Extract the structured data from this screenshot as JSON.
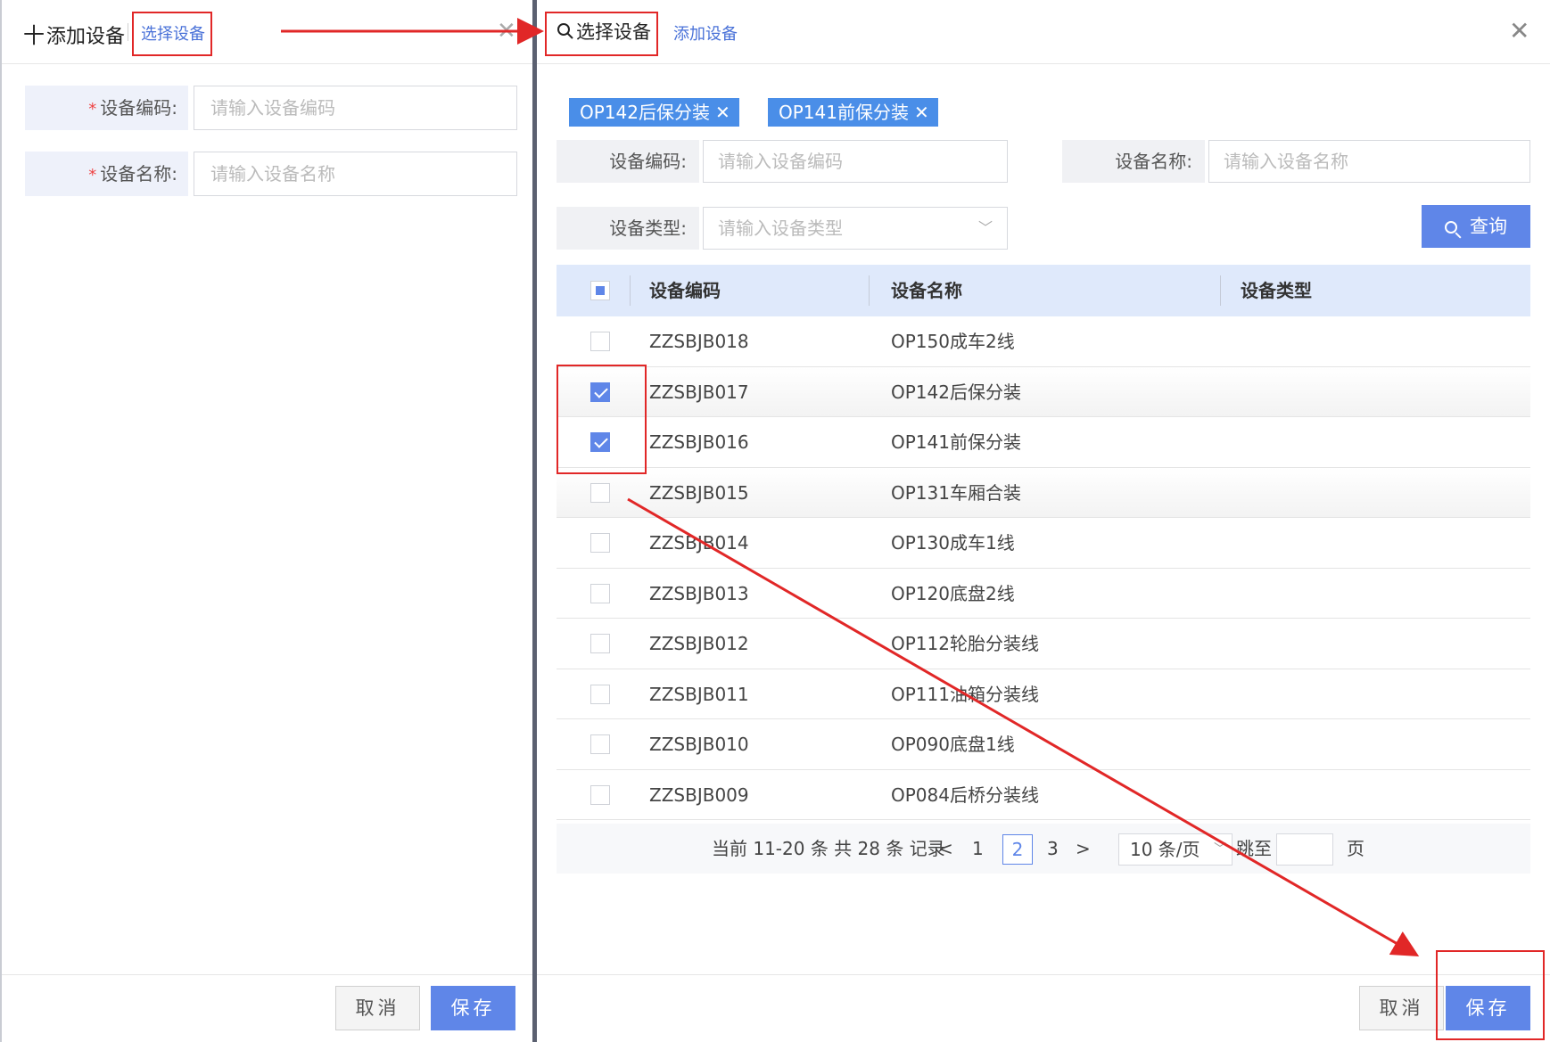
{
  "left_panel": {
    "tab_active": "添加设备",
    "tab_active_prefix": "十",
    "tab_link": "选择设备",
    "close_glyph": "✕",
    "fields": [
      {
        "label": "设备编码:",
        "required_mark": "*",
        "placeholder": "请输入设备编码"
      },
      {
        "label": "设备名称:",
        "required_mark": "*",
        "placeholder": "请输入设备名称"
      }
    ],
    "cancel_label": "取消",
    "save_label": "保存"
  },
  "right_panel": {
    "tab_active": "选择设备",
    "tab_link": "添加设备",
    "close_glyph": "✕",
    "chips": [
      {
        "label": "OP142后保分装",
        "remove_glyph": "✕"
      },
      {
        "label": "OP141前保分装",
        "remove_glyph": "✕"
      }
    ],
    "filters": {
      "code_label": "设备编码:",
      "code_placeholder": "请输入设备编码",
      "name_label": "设备名称:",
      "name_placeholder": "请输入设备名称",
      "type_label": "设备类型:",
      "type_placeholder": "请输入设备类型",
      "type_chevron": "﹀"
    },
    "query_label": "查询",
    "table": {
      "headers": [
        "设备编码",
        "设备名称",
        "设备类型"
      ],
      "rows": [
        {
          "code": "ZZSBJB018",
          "name": "OP150成车2线",
          "type": "",
          "checked": false
        },
        {
          "code": "ZZSBJB017",
          "name": "OP142后保分装",
          "type": "",
          "checked": true
        },
        {
          "code": "ZZSBJB016",
          "name": "OP141前保分装",
          "type": "",
          "checked": true
        },
        {
          "code": "ZZSBJB015",
          "name": "OP131车厢合装",
          "type": "",
          "checked": false
        },
        {
          "code": "ZZSBJB014",
          "name": "OP130成车1线",
          "type": "",
          "checked": false
        },
        {
          "code": "ZZSBJB013",
          "name": "OP120底盘2线",
          "type": "",
          "checked": false
        },
        {
          "code": "ZZSBJB012",
          "name": "OP112轮胎分装线",
          "type": "",
          "checked": false
        },
        {
          "code": "ZZSBJB011",
          "name": "OP111油箱分装线",
          "type": "",
          "checked": false
        },
        {
          "code": "ZZSBJB010",
          "name": "OP090底盘1线",
          "type": "",
          "checked": false
        },
        {
          "code": "ZZSBJB009",
          "name": "OP084后桥分装线",
          "type": "",
          "checked": false
        }
      ]
    },
    "pagination": {
      "summary": "当前 11-20 条 共 28 条 记录",
      "prev": "<",
      "next": ">",
      "pages": [
        "1",
        "2",
        "3"
      ],
      "current_page": "2",
      "page_size": "10 条/页",
      "jump_label": "跳至",
      "jump_value": "",
      "page_suffix": "页"
    },
    "cancel_label": "取消",
    "save_label": "保存"
  },
  "colors": {
    "accent": "#5f86e8",
    "chip": "#4a8ee8",
    "annotation": "#e12727",
    "header_row": "#dfe9fb"
  }
}
